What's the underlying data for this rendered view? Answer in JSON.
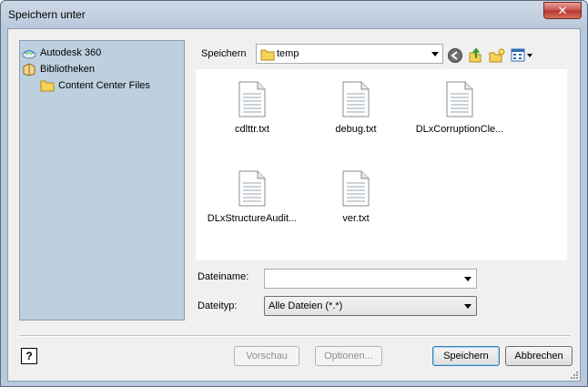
{
  "window": {
    "title": "Speichern unter",
    "close_glyph": "✕"
  },
  "places": [
    {
      "label": "Autodesk 360",
      "icon": "cloud-icon"
    },
    {
      "label": "Bibliotheken",
      "icon": "library-icon"
    },
    {
      "label": "Content Center Files",
      "icon": "folder-icon"
    }
  ],
  "location": {
    "label": "Speichern",
    "value": "temp"
  },
  "files": [
    {
      "name": "cdlttr.txt"
    },
    {
      "name": "debug.txt"
    },
    {
      "name": "DLxCorruptionCle..."
    },
    {
      "name": "DLxStructureAudit..."
    },
    {
      "name": "ver.txt"
    }
  ],
  "filename": {
    "label": "Dateiname:",
    "value": ""
  },
  "filetype": {
    "label": "Dateityp:",
    "value": "Alle Dateien (*.*)"
  },
  "buttons": {
    "preview": "Vorschau",
    "options": "Optionen...",
    "save": "Speichern",
    "cancel": "Abbrechen"
  },
  "help_glyph": "?"
}
